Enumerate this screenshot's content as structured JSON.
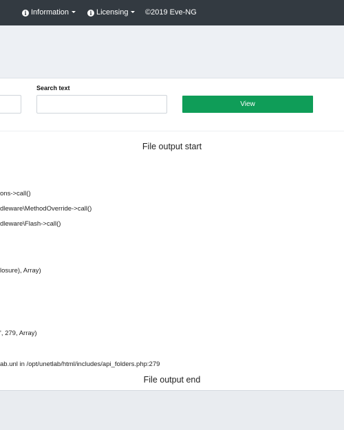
{
  "navbar": {
    "items": [
      {
        "label": "Information",
        "icon": "info-circle-icon"
      },
      {
        "label": "Licensing",
        "icon": "info-circle-icon"
      }
    ],
    "copyright": "©2019 Eve-NG"
  },
  "form": {
    "search_label": "Search text",
    "search_value": "",
    "view_label": "View"
  },
  "output": {
    "start": "File output start",
    "end": "File output end",
    "lines": [
      "ons->call()",
      "dleware\\MethodOverride->call()",
      "dleware\\Flash->call()",
      "losure), Array)",
      "', 279, Array)",
      "ab.unl in /opt/unetlab/html/includes/api_folders.php:279"
    ]
  },
  "colors": {
    "navbar": "#333a41",
    "view_button": "#0f9d58"
  }
}
